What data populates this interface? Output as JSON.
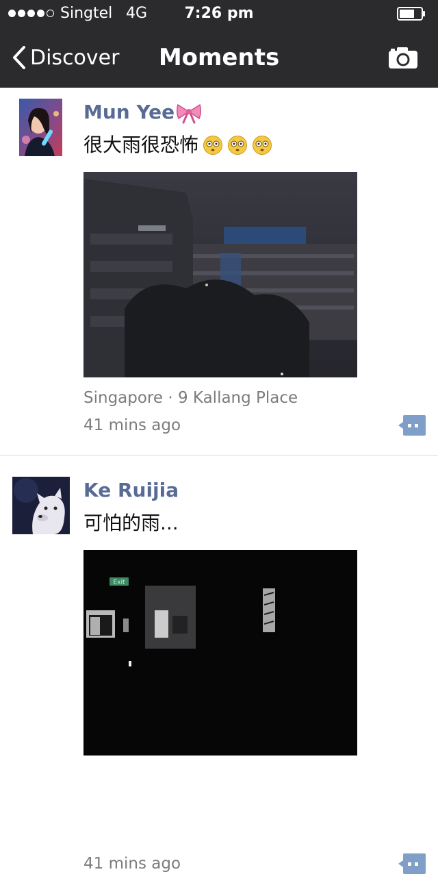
{
  "status_bar": {
    "carrier": "Singtel",
    "network": "4G",
    "time": "7:26 pm",
    "signal_bars_filled": 4,
    "signal_bars_total": 5
  },
  "nav": {
    "back_label": "Discover",
    "title": "Moments",
    "camera_icon": "camera-icon"
  },
  "posts": [
    {
      "username": "Mun Yee",
      "username_decoration": "bow-emoji",
      "text": "很大雨很恐怖",
      "text_emojis": [
        "flushed-face-emoji",
        "flushed-face-emoji",
        "flushed-face-emoji"
      ],
      "location": "Singapore · 9 Kallang Place",
      "time_ago": "41 mins ago"
    },
    {
      "username": "Ke Ruijia",
      "text": "可怕的雨...",
      "photo_sign": "Exit",
      "time_ago": "41 mins ago"
    }
  ],
  "colors": {
    "bar_background": "#2b2b2d",
    "username": "#576b95",
    "meta_text": "#7c7c7c",
    "comment_button": "#7f9fc8"
  }
}
